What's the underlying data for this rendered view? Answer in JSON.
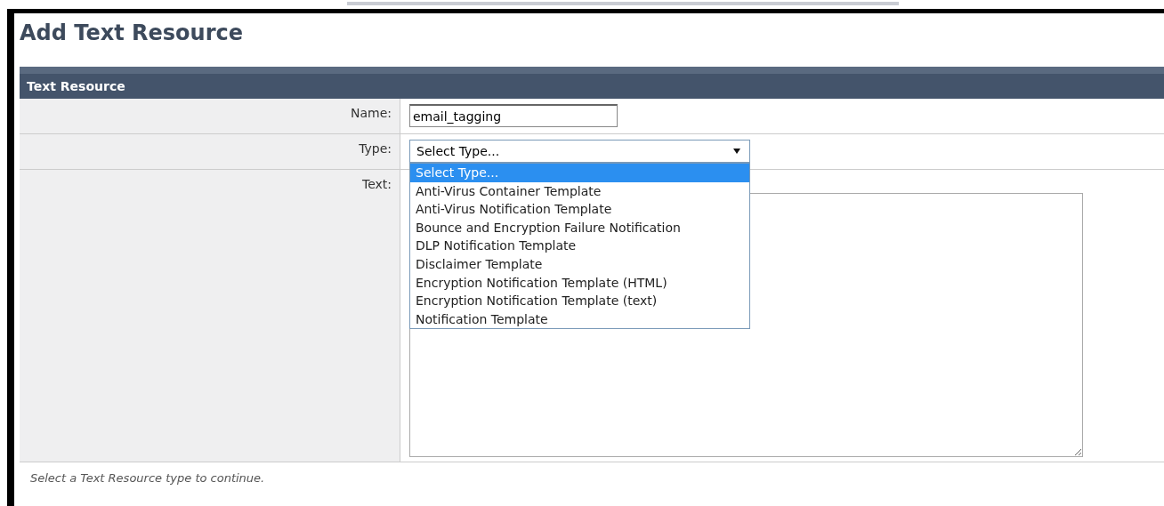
{
  "title": "Add Text Resource",
  "section": {
    "heading": "Text Resource"
  },
  "name_field": {
    "label": "Name:",
    "value": "email_tagging"
  },
  "type_field": {
    "label": "Type:",
    "value": "Select Type...",
    "expanded": true,
    "options": [
      {
        "label": "Select Type...",
        "selected": true
      },
      {
        "label": "Anti-Virus Container Template",
        "selected": false
      },
      {
        "label": "Anti-Virus Notification Template",
        "selected": false
      },
      {
        "label": "Bounce and Encryption Failure Notification",
        "selected": false
      },
      {
        "label": "DLP Notification Template",
        "selected": false
      },
      {
        "label": "Disclaimer Template",
        "selected": false
      },
      {
        "label": "Encryption Notification Template (HTML)",
        "selected": false
      },
      {
        "label": "Encryption Notification Template (text)",
        "selected": false
      },
      {
        "label": "Notification Template",
        "selected": false
      }
    ]
  },
  "text_field": {
    "label": "Text:"
  },
  "footer_note": "Select a Text Resource type to continue."
}
